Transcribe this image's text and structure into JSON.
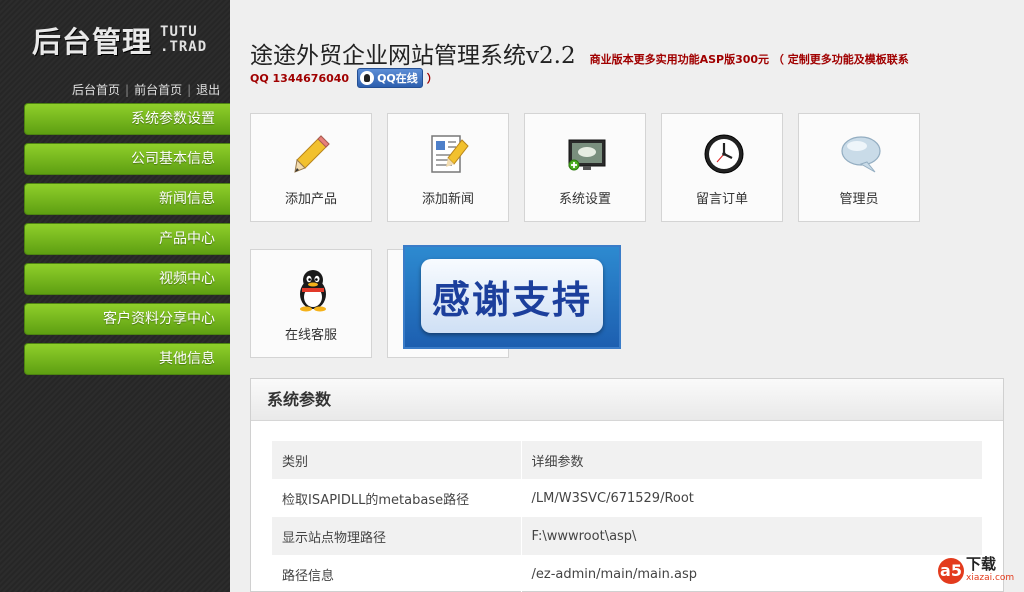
{
  "logo": {
    "main": "后台管理",
    "sub1": "TUTU",
    "sub2": ".TRAD"
  },
  "toplinks": {
    "admin_home": "后台首页",
    "front_home": "前台首页",
    "logout": "退出",
    "separator": "|"
  },
  "menu": {
    "items": [
      {
        "label": "系统参数设置"
      },
      {
        "label": "公司基本信息"
      },
      {
        "label": "新闻信息"
      },
      {
        "label": "产品中心"
      },
      {
        "label": "视频中心"
      },
      {
        "label": "客户资料分享中心"
      },
      {
        "label": "其他信息"
      }
    ]
  },
  "header": {
    "title": "途途外贸企业网站管理系统v2.2",
    "promo": "商业版本更多实用功能ASP版300元 （ 定制更多功能及模板联系",
    "qq_text": "QQ 1344676040",
    "qq_button": "QQ在线",
    "promo_close": "）"
  },
  "tiles": [
    {
      "label": "添加产品",
      "icon": "pencil-icon"
    },
    {
      "label": "添加新闻",
      "icon": "news-icon"
    },
    {
      "label": "系统设置",
      "icon": "monitor-icon"
    },
    {
      "label": "留言订单",
      "icon": "clock-icon"
    },
    {
      "label": "管理员",
      "icon": "chat-bubble-icon"
    },
    {
      "label": "在线客服",
      "icon": "qq-penguin-icon"
    }
  ],
  "banner": {
    "text": "感谢支持"
  },
  "panel": {
    "title": "系统参数",
    "columns": [
      "类别",
      "详细参数"
    ],
    "rows": [
      [
        "检取ISAPIDLL的metabase路径",
        "/LM/W3SVC/671529/Root"
      ],
      [
        "显示站点物理路径",
        "F:\\wwwroot\\asp\\"
      ],
      [
        "路径信息",
        "/ez-admin/main/main.asp"
      ]
    ]
  },
  "watermark": {
    "badge": "a5",
    "cn": "下载",
    "url": "xiazai.com"
  },
  "colors": {
    "menu_green": "#7cc01e",
    "promo_red": "#a00000",
    "sidebar_dark": "#2a2a2a"
  }
}
